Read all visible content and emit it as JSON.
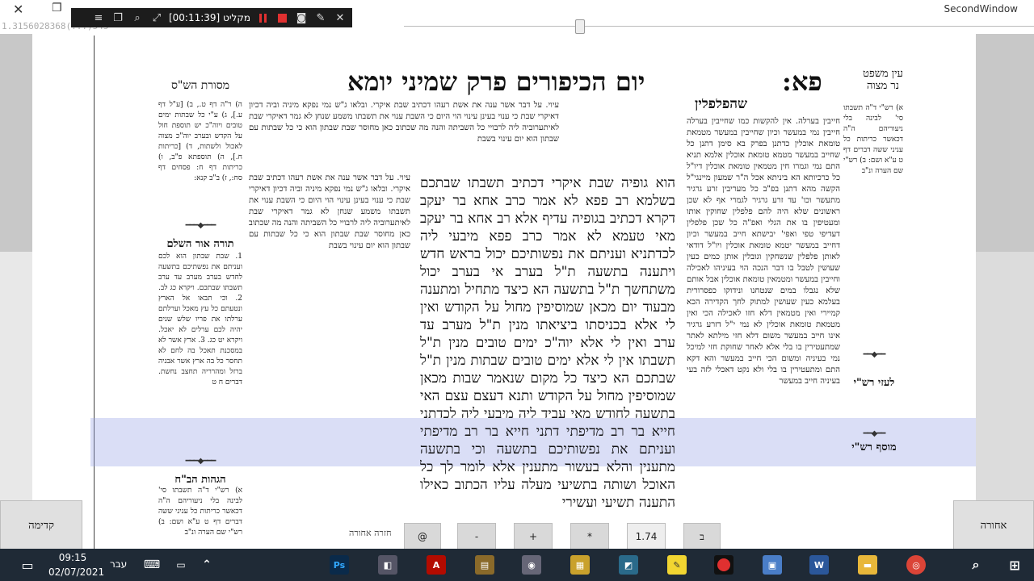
{
  "window": {
    "title": "SecondWindow",
    "close_glyph": "✕",
    "restore_glyph": "❐",
    "coord_readout": "1.3156028368(...)545"
  },
  "recorder": {
    "status": "מקליט [00:11:39]",
    "pause_color": "#e03030",
    "stop_color": "#e03030"
  },
  "page": {
    "folio": "פא:",
    "running_title": "יום הכיפורים   פרק שמיני   יומא",
    "ein_mishpat": "עין משפט\nנר מצוה",
    "mesoret": "מסורת הש\"ס",
    "torah_or": "תורה אור השלם",
    "hagahot": "הגהות הב\"ח",
    "laazei_rashi": "לעזי רש\"י",
    "musaf_rashi": "מוסף רש\"י",
    "rashi_lead": "שהפלפלין",
    "main_text": "הוא גופיה שבת איקרי דכתיב תשבתו שבתכם בשלמא רב פפא לא אמר כרב אחא בר יעקב דקרא דכתיב בגופיה עדיף אלא רב אחא בר יעקב מאי טעמא לא אמר כרב פפא מיבעי ליה לכדתניא ועניתם את נפשותיכם יכול בראש חדש ויתענה בתשעה ת\"ל בערב אי בערב יכול משתחשך ת\"ל בתשעה הא כיצד מתחיל ומתענה מבעוד יום מכאן שמוסיפין מחול על הקודש ואין לי אלא בכניסתו ביציאתו מנין ת\"ל מערב עד ערב ואין לי אלא יוה\"כ ימים טובים מנין ת\"ל תשבתו אין לי אלא ימים טובים שבתות מנין ת\"ל שבתכם הא כיצד כל מקום שנאמר שבות מכאן שמוסיפין מחול על הקודש ותנא דעצם עצם האי בתשעה לחודש מאי עביד ליה מיבעי ליה לכדתני חייא בר רב מדיפתי דתני חייא בר רב מדיפתי ועניתם את נפשותיכם בתשעה וכי בתשעה מתענין והלא בעשור מתענין אלא לומר לך כל האוכל ושותה בתשיעי מעלה עליו הכתוב כאילו התענה תשיעי ועשירי",
    "rashi_text": "חייבין בערלה. אין להקשות כמו שחייבין בערלה חייבין נמי במעשר וכיון שחייבין במעשר מטמאת טומאת אוכלין כדתנן בפרק בא סימן דתנן כל שחייב במעשר מטמא טומאת אוכלין אלמא תניא התם נמי וגמרו חין מטמאין טומאת אוכלין דיו\"ל כל כרכיותא הא ביניתא אכל ה\"ר שמעון מיינגי\"ל הקשה מהא דתנן בפ\"ב כל מעריבין זרע גרגיר מתעשר וכו' עד זרע גרגיר לגמרי אף לא שכן ראשונים שלא היה להם פלפלין שחוקין אותו ומעטיפין בו את הגלי ואפ\"ה כל שכן פלפלין דעדיפי טפי ואפי' יבישתא חייב במעשר וכיון דחייב במעשר יטמא טומאת אוכלין ויו\"ל דודאי לאותן פלפלין שנשחקין וגובלין אותן כמים כעין שעושין לטבל בו דבר הנכה הוי בעיניהו לאכילה וחייבין במעשר ומטמאין טומאת אוכלין אבל אותם שלא נגבלו במים שנטחנו ונידוקו כפסרורית בעלמא כעין שעושין למתוק לחך הקדירה הכא קמיירי ואין מטמאין דלא חזו לאכילה הכי ואין מטמאת טומאת אוכלין לא נמי י\"ל דזרע גרגיר אינו חייב במעשר משום דלא חזי מילתא לאתר שמתעטירין בו בלי אלא לאחר שחוקת חזי למיכל נמי בעיניה ומשום הכי חייב במעשר והא דקא התם ומתעטירין בו בלי ולא נקט דאכלי לזה בעי בעיניה חייב במעשר",
    "tosafot_text": "עיוי. על דבר אשר ענה את אשת רעהו דכתיב שבת איקרי. ובלאו ג\"ש נמי נפקא מיניה וביה דכיון דאיקרי שבת כי ענוי בעינן עינוי הוי היום כי השבת ענוי את תשבתו משמע שנחן לא גמר דאיקרי שבת לאיתערוביה ליה לרבויי כל השביתה והנה מה שכתוב כאן מחוסר שבת שבתון הוא כי כל שבתות עם שבתון הוא יום עינוי בשבת",
    "left_col_a": "ה) ר\"ה דף ט., ב) [ע\"ל דף ע.], ג) ע\"י כל שבתות ימים טובים ויוה\"כ יש תוספת חול על הקדש ובערב יוה\"כ מצוה לאכול ולשתות, ד) [כריתות ח.], ה) תוספתא פ\"ב, ו) כריתות דף ח: פסחים דף סח:, ז) ב\"ב קנא:",
    "left_col_b": "1. שבת שבתון הוא לכם ועניתם את נפשתיכם בתשעה לחדש בערב מערב עד ערב תשבתו שבתכם. ויקרא כג לב. 2. וכי תבאו אל הארץ ונטעתם כל עץ מאכל וערלתם ערלתו את פריו שלש שנים יהיה לכם ערלים לא יאכל. ויקרא יט כג. 3. ארץ אשר לא במסכנת תאכל בה לחם לא תחסר כל בה ארץ אשר אבניה ברזל ומהרריה תחצב נחשת. דברים ח ט",
    "left_col_c": "א) רש\"י ד\"ה תשבתו סי' לבינה בלי ניעוריהם ה\"ה דכאשר כריתות כל עניני ששה דברים דף ט ע\"א ושם: ב) רש\"י שם הערה ונ\"ב"
  },
  "controls": {
    "prev_label": "קדימה",
    "next_label": "אחורה",
    "back_label": "חזרה אחורה",
    "at_label": "@",
    "minus_label": "-",
    "plus_label": "+",
    "star_label": "*",
    "zoom_value": "1.74",
    "b_label": "ב"
  },
  "taskbar": {
    "time": "09:15",
    "date": "02/07/2021",
    "lang": "עבר"
  },
  "colors": {
    "highlight": "#9aa0e6",
    "taskbar": "#1f2a36"
  }
}
